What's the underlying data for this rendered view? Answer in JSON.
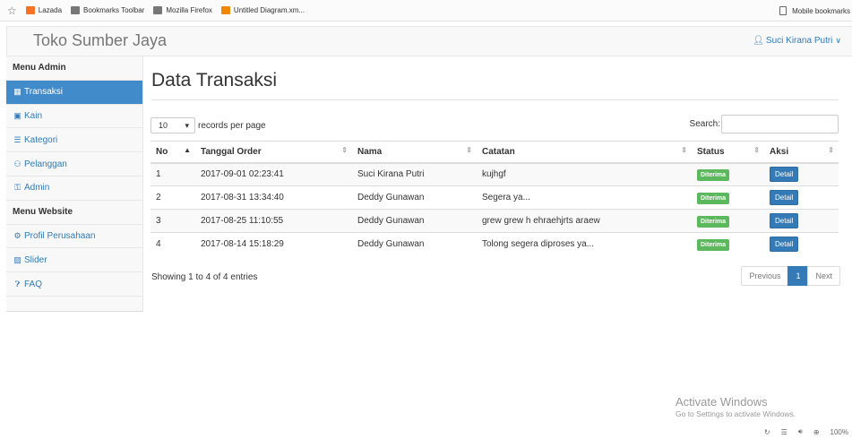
{
  "bookmarks": {
    "items": [
      {
        "label": "Lazada",
        "icon": "lazada-icon"
      },
      {
        "label": "Bookmarks Toolbar",
        "icon": "folder-icon"
      },
      {
        "label": "Mozilla Firefox",
        "icon": "folder-icon"
      },
      {
        "label": "Untitled Diagram.xm...",
        "icon": "drawio-icon"
      }
    ],
    "mobile_label": "Mobile bookmarks"
  },
  "navbar": {
    "brand": "Toko Sumber Jaya",
    "user": "Suci Kirana Putri"
  },
  "sidebar": {
    "items": [
      {
        "label": "Menu Admin",
        "type": "header"
      },
      {
        "label": "Transaksi",
        "icon": "chart-icon",
        "active": true
      },
      {
        "label": "Kain",
        "icon": "grid-icon"
      },
      {
        "label": "Kategori",
        "icon": "list-icon"
      },
      {
        "label": "Pelanggan",
        "icon": "users-icon"
      },
      {
        "label": "Admin",
        "icon": "key-icon"
      },
      {
        "label": "Menu Website",
        "type": "header"
      },
      {
        "label": "Profil Perusahaan",
        "icon": "cogs-icon"
      },
      {
        "label": "Slider",
        "icon": "image-icon"
      },
      {
        "label": "FAQ",
        "icon": "question-icon"
      }
    ]
  },
  "main": {
    "title": "Data Transaksi",
    "length_value": "10",
    "length_suffix": "records per page",
    "search_label": "Search:",
    "columns": [
      "No",
      "Tanggal Order",
      "Nama",
      "Catatan",
      "Status",
      "Aksi"
    ],
    "rows": [
      {
        "no": "1",
        "tanggal": "2017-09-01 02:23:41",
        "nama": "Suci Kirana Putri",
        "catatan": "kujhgf",
        "status": "Diterima",
        "aksi": "Detail"
      },
      {
        "no": "2",
        "tanggal": "2017-08-31 13:34:40",
        "nama": "Deddy Gunawan",
        "catatan": "Segera ya...",
        "status": "Diterima",
        "aksi": "Detail"
      },
      {
        "no": "3",
        "tanggal": "2017-08-25 11:10:55",
        "nama": "Deddy Gunawan",
        "catatan": "grew grew h ehraehjrts araew",
        "status": "Diterima",
        "aksi": "Detail"
      },
      {
        "no": "4",
        "tanggal": "2017-08-14 15:18:29",
        "nama": "Deddy Gunawan",
        "catatan": "Tolong segera diproses ya...",
        "status": "Diterima",
        "aksi": "Detail"
      }
    ],
    "info": "Showing 1 to 4 of 4 entries",
    "pager": {
      "previous": "Previous",
      "page": "1",
      "next": "Next"
    }
  },
  "watermark": {
    "title": "Activate Windows",
    "subtitle": "Go to Settings to activate Windows."
  },
  "statusbar": {
    "zoom": "100%"
  },
  "colors": {
    "primary": "#337ab7",
    "active_sidebar": "#428bca",
    "success": "#5cb85c"
  }
}
